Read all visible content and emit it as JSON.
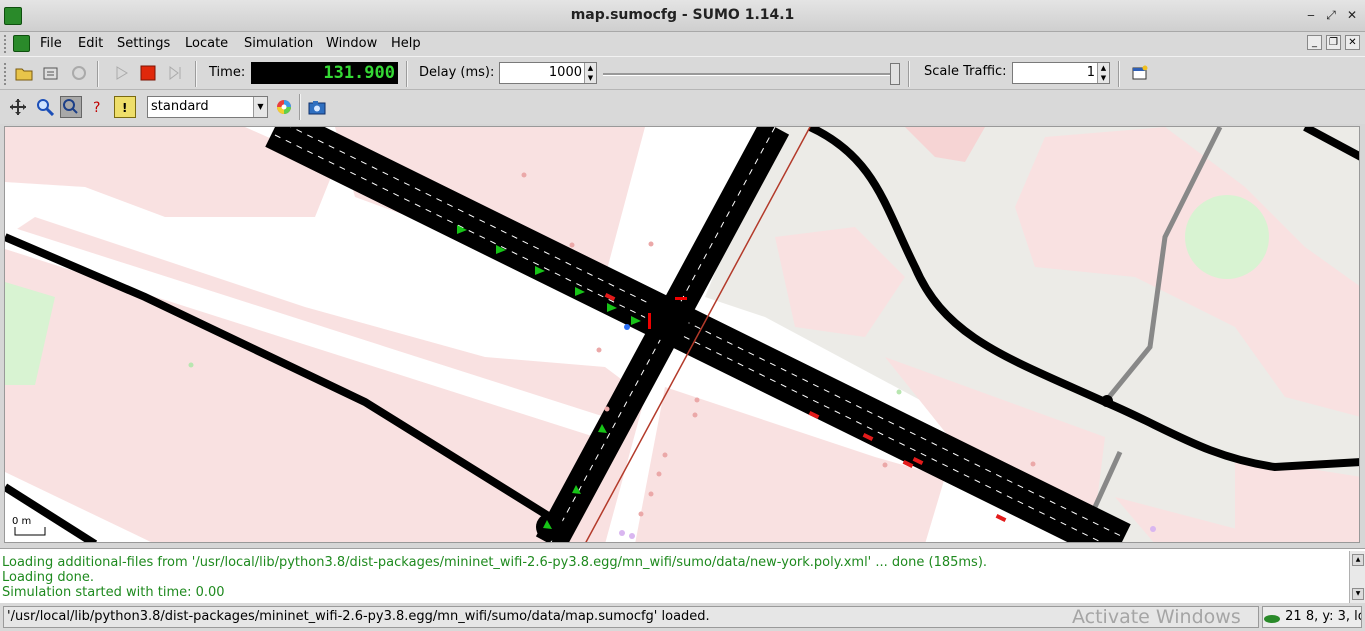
{
  "window": {
    "title": "map.sumocfg - SUMO 1.14.1"
  },
  "menu": {
    "items": [
      {
        "label": "File"
      },
      {
        "label": "Edit"
      },
      {
        "label": "Settings"
      },
      {
        "label": "Locate"
      },
      {
        "label": "Simulation"
      },
      {
        "label": "Window"
      },
      {
        "label": "Help"
      }
    ]
  },
  "toolbar": {
    "time_label": "Time:",
    "time_value": "131.900",
    "delay_label": "Delay (ms):",
    "delay_value": "1000",
    "delay_slider_fraction": 0.97,
    "scale_label": "Scale Traffic:",
    "scale_value": "1"
  },
  "view_toolbar": {
    "color_scheme": "standard"
  },
  "map": {
    "scale_label": "0        m"
  },
  "log": {
    "lines": [
      "Loading additional-files from '/usr/local/lib/python3.8/dist-packages/mininet_wifi-2.6-py3.8.egg/mn_wifi/sumo/data/new-york.poly.xml' ... done (185ms).",
      "Loading done.",
      "Simulation started with time: 0.00"
    ]
  },
  "status": {
    "message": "'/usr/local/lib/python3.8/dist-packages/mininet_wifi-2.6-py3.8.egg/mn_wifi/sumo/data/map.sumocfg' loaded.",
    "coords": "21  8, y: 3, lo",
    "watermark": "Activate Windows"
  }
}
